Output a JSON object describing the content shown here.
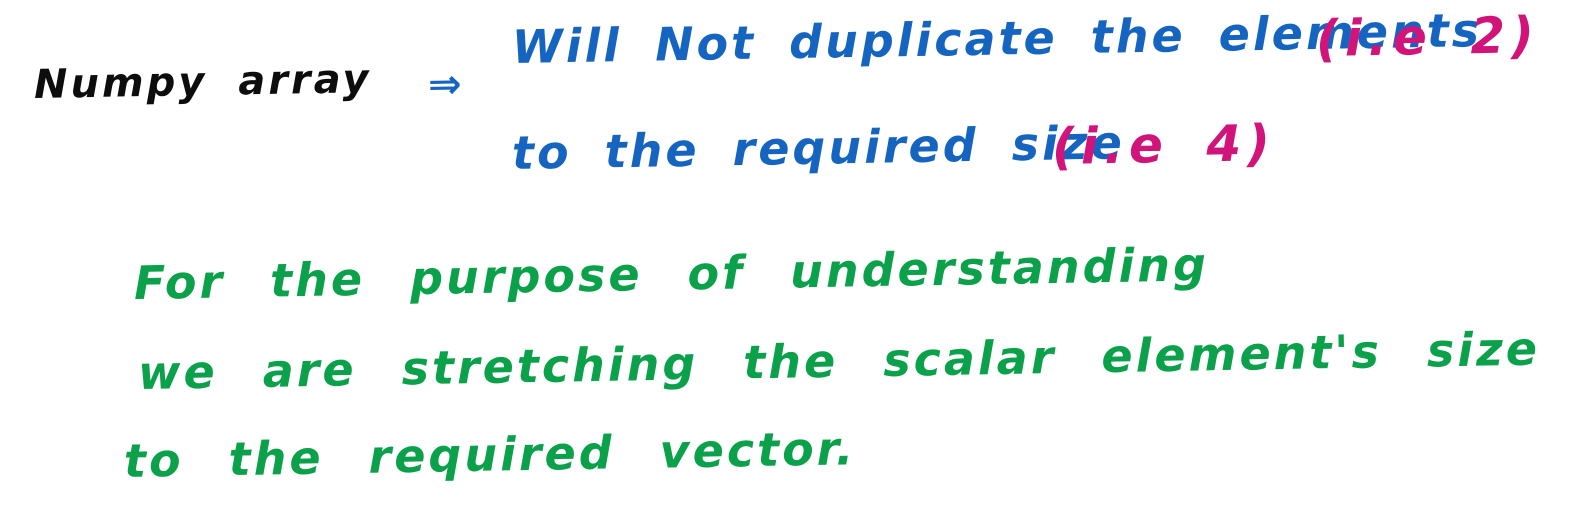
{
  "colors": {
    "black": "#0d0d0d",
    "blue": "#1565c0",
    "magenta": "#d1147a",
    "green": "#0aa14a",
    "background": "#ffffff"
  },
  "note": {
    "label": "Numpy array",
    "arrow": "⇒",
    "line1": "Will Not duplicate the elements",
    "line1_note": "(i.e 2)",
    "line2": "to the required size",
    "line2_note": "(i.e 4)",
    "green_line1": "For the purpose of understanding",
    "green_line2": "we are stretching the scalar element's size",
    "green_line3": "to the required vector."
  }
}
